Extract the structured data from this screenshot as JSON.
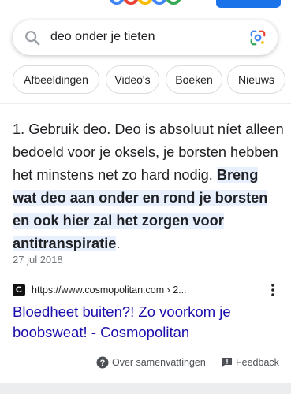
{
  "search": {
    "query": "deo onder je tieten"
  },
  "chips": [
    {
      "label": "Afbeeldingen"
    },
    {
      "label": "Video's"
    },
    {
      "label": "Boeken"
    },
    {
      "label": "Nieuws"
    }
  ],
  "snippet": {
    "plain": "1. Gebruik deo. Deo is absoluut níet alleen bedoeld voor je oksels, je borsten hebben het minstens net zo hard nodig. ",
    "highlight": "Breng wat deo aan onder en rond je borsten en ook hier zal het zorgen voor antitranspiratie",
    "tail": ".",
    "date": "27 jul 2018"
  },
  "result": {
    "favicon_letter": "C",
    "url": "https://www.cosmopolitan.com › 2...",
    "title": "Bloedheet buiten?! Zo voorkom je boobsweat! - Cosmopolitan"
  },
  "footer": {
    "about_label": "Over samenvattingen",
    "feedback_label": "Feedback"
  },
  "colors": {
    "link": "#1a0dab",
    "highlight_bg": "#e8f0fe",
    "brand_blue": "#1a73e8"
  }
}
